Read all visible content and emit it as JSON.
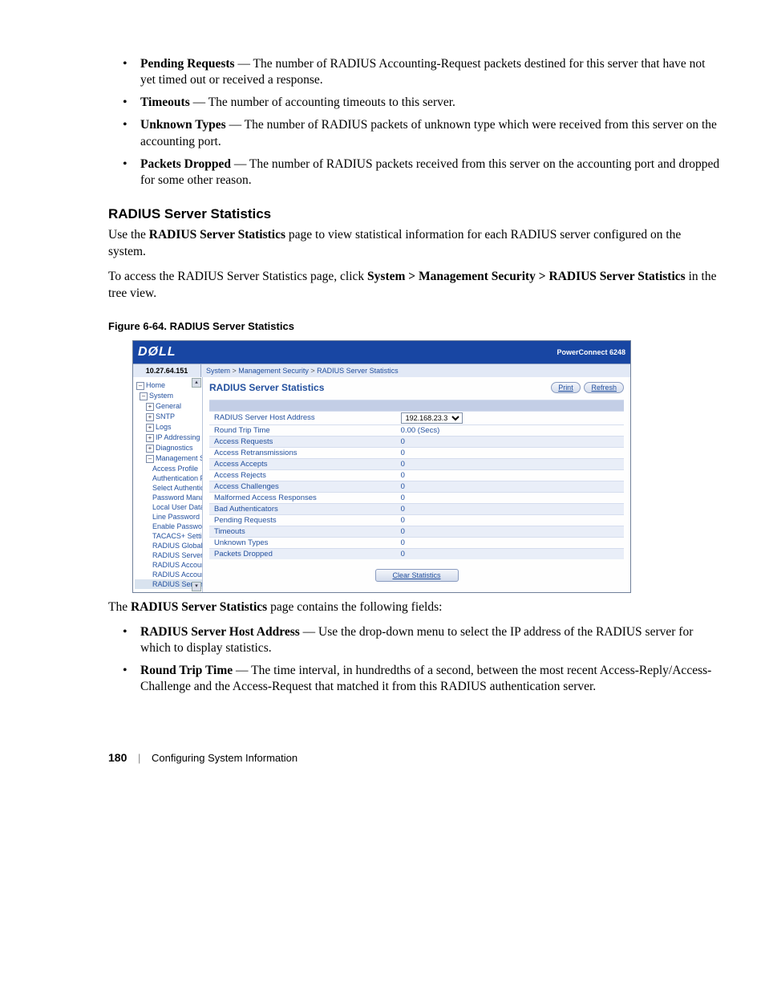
{
  "bullets_top": [
    {
      "term": "Pending Requests",
      "desc": " — The number of RADIUS Accounting-Request packets destined for this server that have not yet timed out or received a response."
    },
    {
      "term": "Timeouts",
      "desc": " — The number of accounting timeouts to this server."
    },
    {
      "term": "Unknown Types",
      "desc": " — The number of RADIUS packets of unknown type which were received from this server on the accounting port."
    },
    {
      "term": "Packets Dropped",
      "desc": " — The number of RADIUS packets received from this server on the accounting port and dropped for some other reason."
    }
  ],
  "section_title": "RADIUS Server Statistics",
  "para1_pre": "Use the ",
  "para1_bold": "RADIUS Server Statistics",
  "para1_post": " page to view statistical information for each RADIUS server configured on the system.",
  "para2_pre": "To access the RADIUS Server Statistics page, click ",
  "para2_bold": "System > Management Security > RADIUS Server Statistics",
  "para2_post": " in the tree view.",
  "figcap": "Figure 6-64.    RADIUS Server Statistics",
  "screenshot": {
    "product": "PowerConnect 6248",
    "logo": "DØLL",
    "ip": "10.27.64.151",
    "crumbs": [
      "System",
      "Management Security",
      "RADIUS Server Statistics"
    ],
    "tree": [
      {
        "lvl": "l0",
        "box": "–",
        "label": "Home"
      },
      {
        "lvl": "l1",
        "box": "–",
        "label": "System"
      },
      {
        "lvl": "l2",
        "box": "+",
        "label": "General"
      },
      {
        "lvl": "l2",
        "box": "+",
        "label": "SNTP"
      },
      {
        "lvl": "l2",
        "box": "+",
        "label": "Logs"
      },
      {
        "lvl": "l2",
        "box": "+",
        "label": "IP Addressing"
      },
      {
        "lvl": "l2",
        "box": "+",
        "label": "Diagnostics"
      },
      {
        "lvl": "l2",
        "box": "–",
        "label": "Management Securi"
      },
      {
        "lvl": "l3",
        "box": "",
        "label": "Access Profile"
      },
      {
        "lvl": "l3",
        "box": "",
        "label": "Authentication P"
      },
      {
        "lvl": "l3",
        "box": "",
        "label": "Select Authentic"
      },
      {
        "lvl": "l3",
        "box": "",
        "label": "Password Manag"
      },
      {
        "lvl": "l3",
        "box": "",
        "label": "Local User Datab"
      },
      {
        "lvl": "l3",
        "box": "",
        "label": "Line Password"
      },
      {
        "lvl": "l3",
        "box": "",
        "label": "Enable Password"
      },
      {
        "lvl": "l3",
        "box": "",
        "label": "TACACS+ Settin"
      },
      {
        "lvl": "l3",
        "box": "",
        "label": "RADIUS Global C"
      },
      {
        "lvl": "l3",
        "box": "",
        "label": "RADIUS Server C"
      },
      {
        "lvl": "l3",
        "box": "",
        "label": "RADIUS Accoun"
      },
      {
        "lvl": "l3",
        "box": "",
        "label": "RADIUS Accoun"
      },
      {
        "lvl": "l3",
        "box": "",
        "label": "RADIUS Server S",
        "sel": true
      }
    ],
    "content_title": "RADIUS Server Statistics",
    "btn_print": "Print",
    "btn_refresh": "Refresh",
    "btn_clear": "Clear Statistics",
    "rows": [
      {
        "label": "RADIUS Server Host Address",
        "value": "192.168.23.3",
        "select": true
      },
      {
        "label": "Round Trip Time",
        "value": "0.00   (Secs)"
      },
      {
        "label": "Access Requests",
        "value": "0",
        "alt": true
      },
      {
        "label": "Access Retransmissions",
        "value": "0"
      },
      {
        "label": "Access Accepts",
        "value": "0",
        "alt": true
      },
      {
        "label": "Access Rejects",
        "value": "0"
      },
      {
        "label": "Access Challenges",
        "value": "0",
        "alt": true
      },
      {
        "label": "Malformed Access Responses",
        "value": "0"
      },
      {
        "label": "Bad Authenticators",
        "value": "0",
        "alt": true
      },
      {
        "label": "Pending Requests",
        "value": "0"
      },
      {
        "label": "Timeouts",
        "value": "0",
        "alt": true
      },
      {
        "label": "Unknown Types",
        "value": "0"
      },
      {
        "label": "Packets Dropped",
        "value": "0",
        "alt": true
      }
    ]
  },
  "para3_pre": "The ",
  "para3_bold": "RADIUS Server Statistics",
  "para3_post": " page contains the following fields:",
  "bullets_bottom": [
    {
      "term": "RADIUS Server Host Address",
      "desc": " — Use the drop-down menu to select the IP address of the RADIUS server for which to display statistics."
    },
    {
      "term": "Round Trip Time",
      "desc": " — The time interval, in hundredths of a second, between the most recent Access-Reply/Access-Challenge and the Access-Request that matched it from this RADIUS authentication server."
    }
  ],
  "footer": {
    "page": "180",
    "chapter": "Configuring System Information"
  }
}
